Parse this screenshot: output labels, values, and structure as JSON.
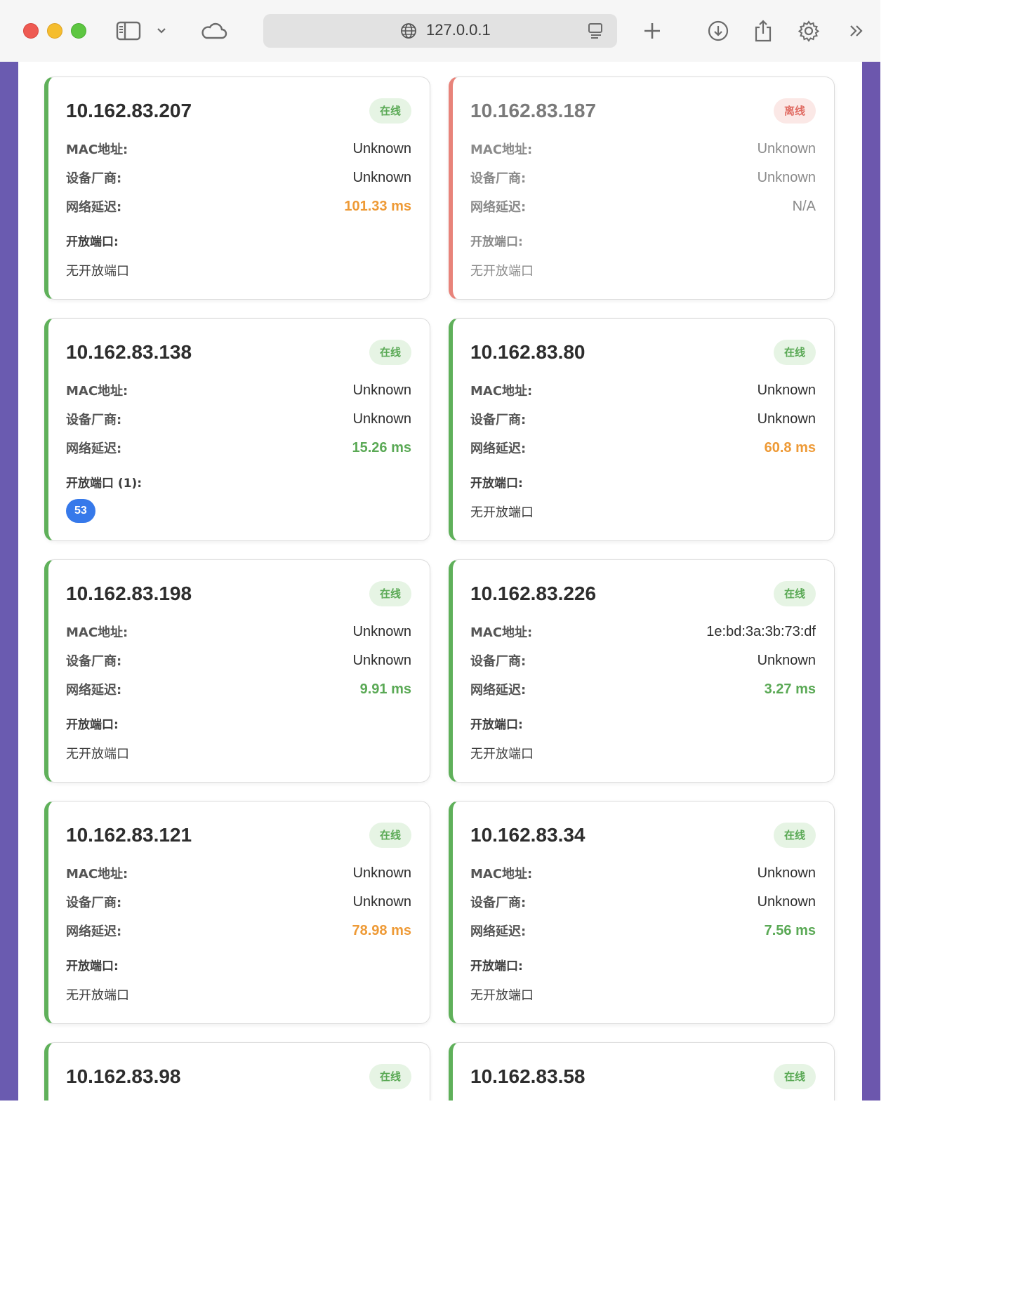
{
  "browser": {
    "url": "127.0.0.1"
  },
  "labels": {
    "mac": "MAC地址:",
    "vendor": "设备厂商:",
    "latency": "网络延迟:",
    "ports": "开放端口:",
    "ports_count_1": "开放端口 (1):",
    "no_ports": "无开放端口"
  },
  "colors": {
    "online_accent": "#5fb05a",
    "offline_accent": "#e8837a",
    "latency_high": "#ee9a36",
    "latency_low": "#5aa955",
    "port_chip": "#3679ea",
    "side_background": "#6a5bb0"
  },
  "devices": [
    {
      "ip": "10.162.83.207",
      "status": "在线",
      "mac": "Unknown",
      "vendor": "Unknown",
      "latency": "101.33 ms"
    },
    {
      "ip": "10.162.83.187",
      "status": "离线",
      "mac": "Unknown",
      "vendor": "Unknown",
      "latency": "N/A"
    },
    {
      "ip": "10.162.83.138",
      "status": "在线",
      "mac": "Unknown",
      "vendor": "Unknown",
      "latency": "15.26 ms",
      "ports": [
        "53"
      ]
    },
    {
      "ip": "10.162.83.80",
      "status": "在线",
      "mac": "Unknown",
      "vendor": "Unknown",
      "latency": "60.8 ms"
    },
    {
      "ip": "10.162.83.198",
      "status": "在线",
      "mac": "Unknown",
      "vendor": "Unknown",
      "latency": "9.91 ms"
    },
    {
      "ip": "10.162.83.226",
      "status": "在线",
      "mac": "1e:bd:3a:3b:73:df",
      "vendor": "Unknown",
      "latency": "3.27 ms"
    },
    {
      "ip": "10.162.83.121",
      "status": "在线",
      "mac": "Unknown",
      "vendor": "Unknown",
      "latency": "78.98 ms"
    },
    {
      "ip": "10.162.83.34",
      "status": "在线",
      "mac": "Unknown",
      "vendor": "Unknown",
      "latency": "7.56 ms"
    },
    {
      "ip": "10.162.83.98",
      "status": "在线"
    },
    {
      "ip": "10.162.83.58",
      "status": "在线"
    }
  ]
}
